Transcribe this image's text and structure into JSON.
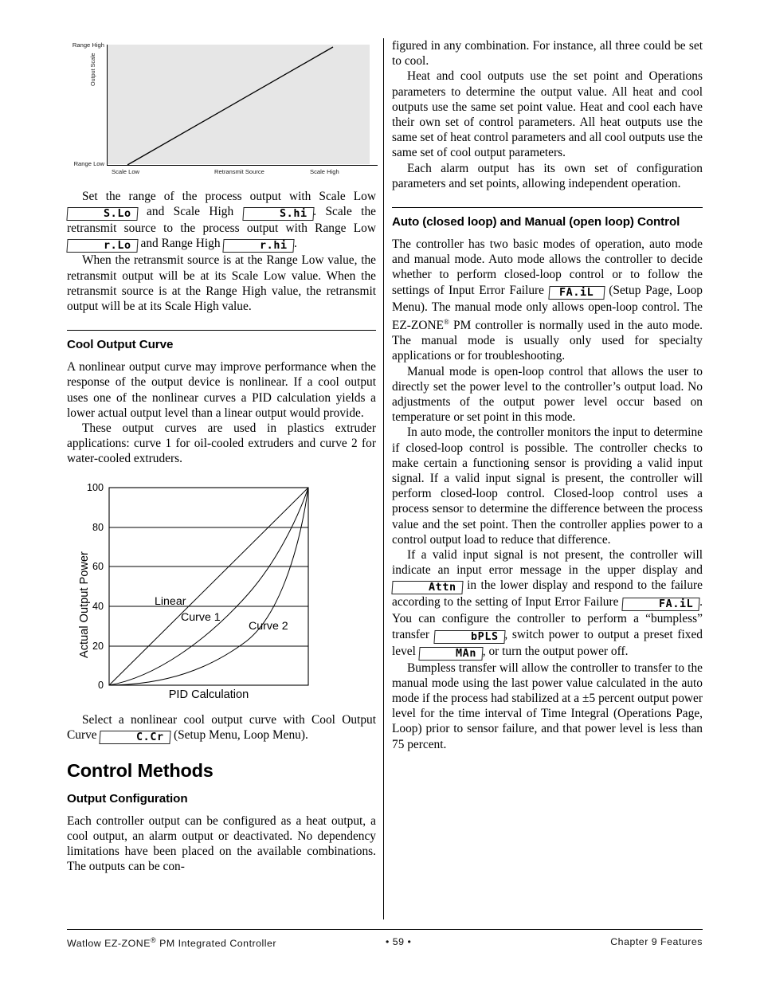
{
  "page": {
    "number": "59"
  },
  "figure1": {
    "name": "retransmit-scaling-diagram",
    "y_axis_title": "Output Scale",
    "y_labels": {
      "high": "Range High",
      "low": "Range Low"
    },
    "x_axis_title": "Retransmit Source",
    "x_labels": {
      "low": "Scale Low",
      "high": "Scale High"
    },
    "plot_fill": "#e6e6e6"
  },
  "chart_data": {
    "type": "line",
    "name": "cool-output-curve-chart",
    "title": "",
    "xlabel": "PID Calculation",
    "ylabel": "Actual Output Power",
    "ylim": [
      0,
      100
    ],
    "xlim": [
      0,
      100
    ],
    "yticks": [
      0,
      20,
      40,
      60,
      80,
      100
    ],
    "ytick_labels": [
      "0",
      "20",
      "40",
      "60",
      "80",
      "100"
    ],
    "grid": "horizontal",
    "legend": "inline-annotations",
    "series": [
      {
        "name": "Linear",
        "label": "Linear",
        "x": [
          0,
          10,
          20,
          30,
          40,
          50,
          60,
          70,
          80,
          90,
          100
        ],
        "values": [
          0,
          10,
          20,
          30,
          40,
          50,
          60,
          70,
          80,
          90,
          100
        ]
      },
      {
        "name": "Curve 1",
        "label": "Curve 1",
        "x": [
          0,
          10,
          20,
          30,
          40,
          50,
          60,
          70,
          80,
          90,
          100
        ],
        "values": [
          0,
          4,
          9,
          15,
          22,
          30,
          40,
          52,
          65,
          81,
          100
        ]
      },
      {
        "name": "Curve 2",
        "label": "Curve 2",
        "x": [
          0,
          10,
          20,
          30,
          40,
          50,
          60,
          70,
          80,
          90,
          100
        ],
        "values": [
          0,
          1,
          3,
          6,
          10,
          16,
          24,
          35,
          50,
          71,
          100
        ]
      }
    ]
  },
  "left_column": {
    "para_scale": {
      "t1": "Set the range of the process output with Scale Low ",
      "code_slo": "S.Lo",
      "t2": " and Scale High ",
      "code_shi": "S.hi",
      "t3": ". Scale the retransmit source to the process output with Range Low ",
      "code_rlo": "r.Lo",
      "t4": " and Range High ",
      "code_rhi": "r.hi",
      "t5": "."
    },
    "para_retransmit": "When the retransmit source is at the Range Low value, the retransmit output will be at its Scale Low value. When the retransmit source is at the Range High value, the retransmit output will be at its Scale High value.",
    "heading_cool_output_curve": "Cool Output Curve",
    "para_nonlinear": "A nonlinear output curve may improve performance when the response of the output device is nonlinear. If a cool output uses one of the nonlinear curves a PID calculation yields a lower actual output level than a linear output would provide.",
    "para_extruder": "These output curves are used in plastics extruder applications: curve 1 for oil-cooled extruders and curve 2 for water-cooled extruders.",
    "para_select": {
      "t1": "Select a nonlinear cool output curve with Cool Output Curve ",
      "code_ccr": "C.Cr",
      "t2": " (Setup Menu, Loop Menu)."
    },
    "heading_control_methods": "Control Methods",
    "heading_output_configuration": "Output Configuration",
    "para_output_config": "Each controller output can be configured as a heat output, a cool output, an alarm output or deactivated. No dependency limitations have been placed on the available combinations. The outputs can be con-"
  },
  "right_column": {
    "para_figured": "figured in any combination. For instance, all three could be set to cool.",
    "para_heatcool": "Heat and cool outputs use the set point and Operations parameters to determine the output value. All heat and cool outputs use the same set point value. Heat and cool each have their own set of control parameters. All heat outputs use the same set of heat control parameters and all cool outputs use the same set of cool output parameters.",
    "para_alarm": "Each alarm output has its own set of configuration parameters and set points, allowing independent operation.",
    "heading_auto_manual": "Auto (closed loop) and Manual (open loop) Control",
    "para_modes": {
      "t1": "The controller has two basic modes of operation, auto mode and manual mode. Auto mode allows the controller to decide whether to perform closed-loop control or to follow the settings of Input Error Failure ",
      "code_fail": "FA.iL",
      "t2": " (Setup Page, Loop Menu). The manual mode only allows open-loop control. The EZ-ZONE",
      "reg": "®",
      "t3": " PM controller is normally used in the auto mode. The manual mode is usually only used for specialty applications or for troubleshooting."
    },
    "para_manual": "Manual mode is open-loop control that allows the user to directly set the power level to the controller’s output load. No adjustments of the output power level occur based on temperature or set point in this mode.",
    "para_auto": "In auto mode, the controller monitors the input to determine if closed-loop control is possible. The controller checks to make certain a functioning sensor is providing a valid input signal. If a valid input signal is present, the controller will perform closed-loop control. Closed-loop control uses a process sensor to determine the difference between the process value and the set point. Then the controller applies power to a control output load to reduce that difference.",
    "para_invalid": {
      "t1": "If a valid input signal is not present, the controller will indicate an input error message in the upper display and ",
      "code_attn": "Attn",
      "t2": " in the lower display and respond to the failure according to the setting of Input Error Failure ",
      "code_fail": "FA.iL",
      "t3": ". You can configure the controller to perform a “bumpless” transfer ",
      "code_bpls": "bPLS",
      "t4": ", switch power to output a preset fixed level ",
      "code_man": "MAn",
      "t5": ", or turn the output power off."
    },
    "para_bumpless": "Bumpless transfer will allow the controller to transfer to the manual mode using the last power value calculated in the auto mode if the process had stabilized at a ±5 percent output power level for the time interval of Time Integral (Operations Page, Loop) prior to sensor failure, and that power level is less than 75 percent."
  },
  "footer": {
    "left": "Watlow EZ-ZONE",
    "left_reg": "®",
    "left_cont": " PM Integrated Controller",
    "middle": "•  59  •",
    "right": "Chapter 9 Features"
  }
}
